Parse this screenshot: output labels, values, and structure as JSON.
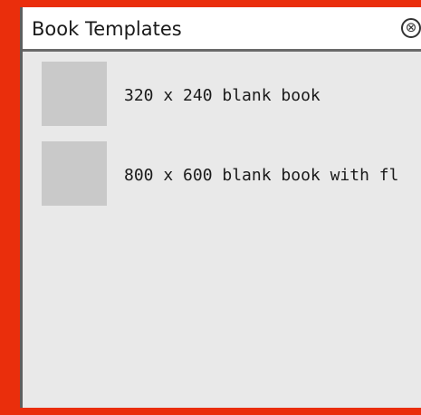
{
  "panel": {
    "title": "Book Templates",
    "close_glyph": "⊗",
    "close_icon": "close-circle-icon"
  },
  "templates": [
    {
      "label": "320 x 240 blank book"
    },
    {
      "label": "800 x 600 blank book with fl"
    }
  ],
  "colors": {
    "frame_border": "#ea2e0c",
    "panel_bg": "#e9e9e9",
    "thumbnail": "#c9c9c9"
  }
}
